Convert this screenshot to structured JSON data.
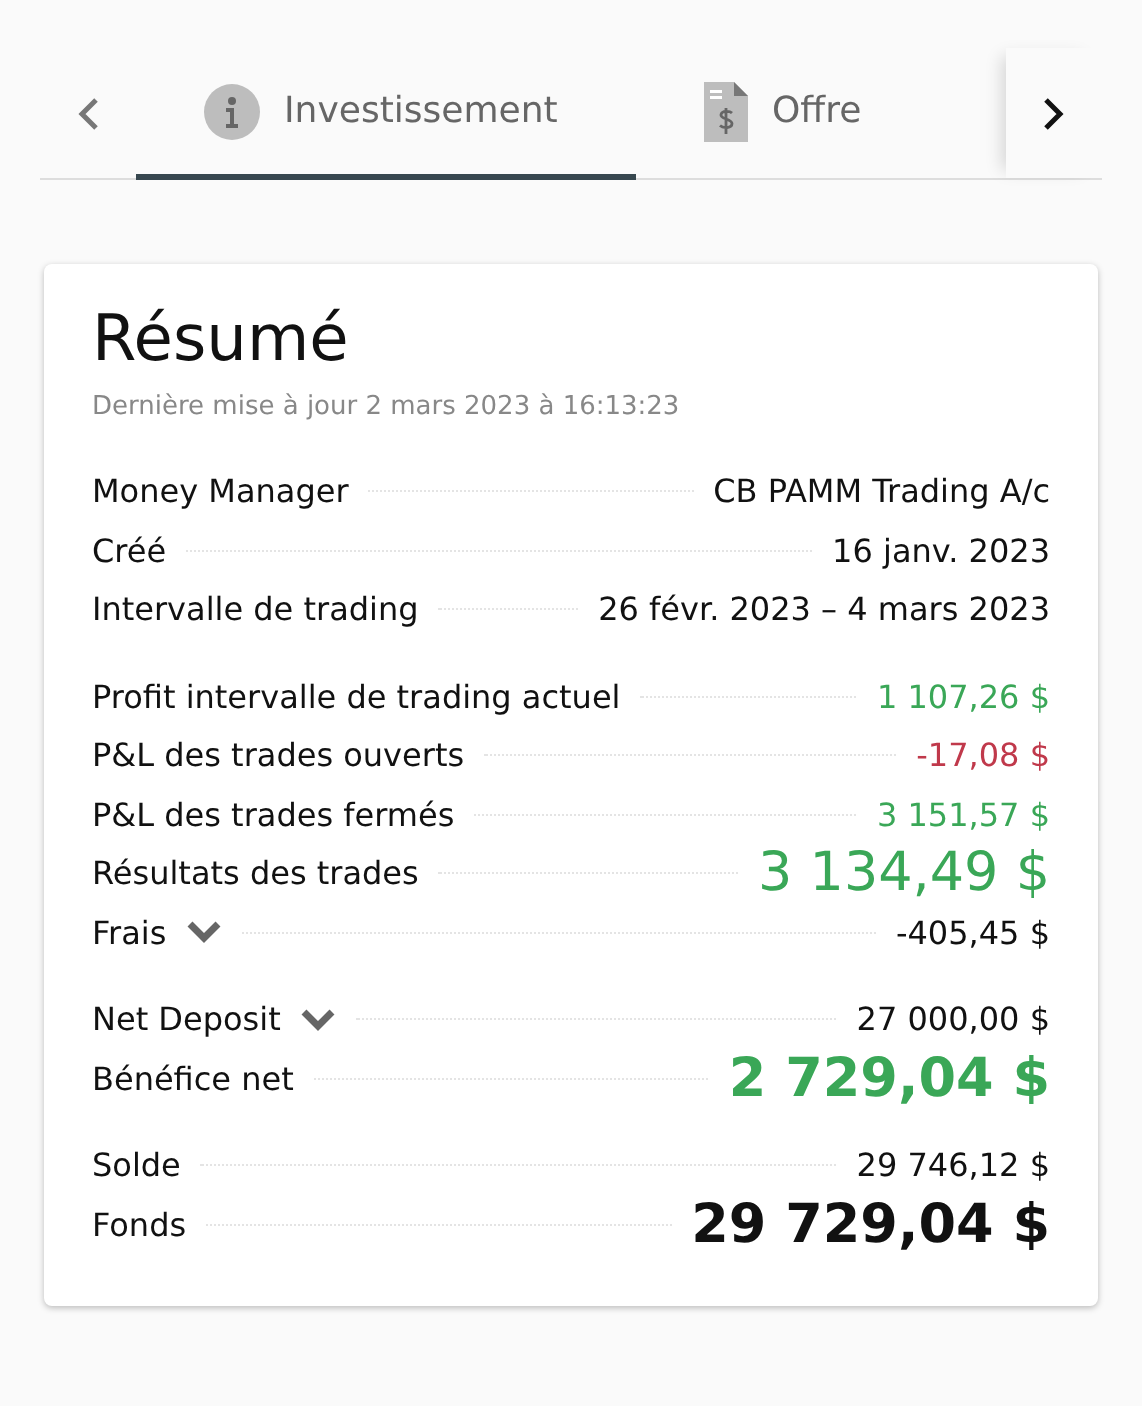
{
  "tabs": [
    {
      "label": "Investissement",
      "kind": "info",
      "selected": true
    },
    {
      "label": "Offre",
      "kind": "document",
      "selected": false
    }
  ],
  "summary": {
    "title": "Résumé",
    "updated": "Dernière mise à jour 2 mars 2023 à 16:13:23",
    "sections": [
      {
        "rows": [
          {
            "label": "Money Manager",
            "value": "CB PAMM Trading A/c",
            "kind": "plain",
            "dropdown": false
          },
          {
            "label": "Créé",
            "value": "16 janv. 2023",
            "kind": "plain",
            "dropdown": false
          },
          {
            "label": "Intervalle de trading",
            "value": "26 févr. 2023 – 4 mars 2023",
            "kind": "plain",
            "dropdown": false
          }
        ]
      },
      {
        "rows": [
          {
            "label": "Profit intervalle de trading actuel",
            "value": "1 107,26 $",
            "kind": "gain",
            "dropdown": false
          },
          {
            "label": "P&L des trades ouverts",
            "value": "-17,08 $",
            "kind": "loss",
            "dropdown": false
          },
          {
            "label": "P&L des trades fermés",
            "value": "3 151,57 $",
            "kind": "gain",
            "dropdown": false
          },
          {
            "label": "Résultats des trades",
            "value": "3 134,49 $",
            "kind": "result",
            "dropdown": false
          },
          {
            "label": "Frais",
            "value": "-405,45 $",
            "kind": "plain",
            "dropdown": true
          }
        ]
      },
      {
        "rows": [
          {
            "label": "Net Deposit",
            "value": "27 000,00 $",
            "kind": "plain",
            "dropdown": true
          },
          {
            "label": "Bénéfice net",
            "value": "2 729,04 $",
            "kind": "net",
            "dropdown": false
          }
        ]
      },
      {
        "rows": [
          {
            "label": "Solde",
            "value": "29 746,12 $",
            "kind": "plain",
            "dropdown": false
          },
          {
            "label": "Fonds",
            "value": "29 729,04 $",
            "kind": "total",
            "dropdown": false
          }
        ]
      }
    ]
  }
}
